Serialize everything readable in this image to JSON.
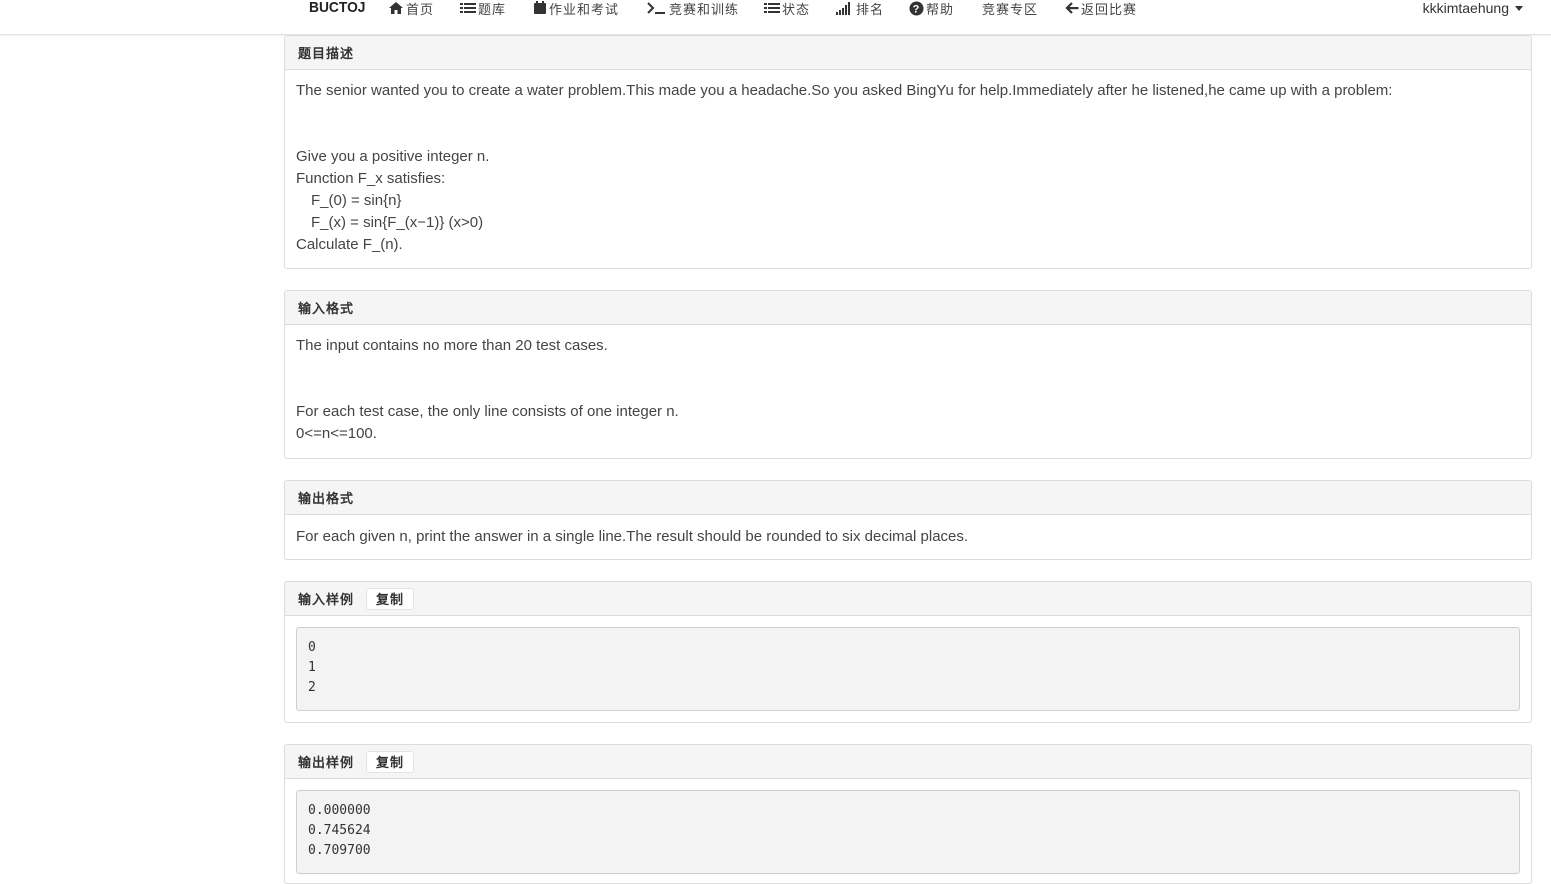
{
  "navbar": {
    "brand": "BUCTOJ",
    "items": [
      {
        "label": "首页",
        "icon": "home-icon"
      },
      {
        "label": "题库",
        "icon": "list-icon"
      },
      {
        "label": "作业和考试",
        "icon": "calendar-icon"
      },
      {
        "label": "竞赛和训练",
        "icon": "terminal-icon"
      },
      {
        "label": "状态",
        "icon": "list-check-icon"
      },
      {
        "label": "排名",
        "icon": "signal-icon"
      },
      {
        "label": "帮助",
        "icon": "question-circle-icon"
      },
      {
        "label": "竞赛专区",
        "icon": ""
      },
      {
        "label": "返回比赛",
        "icon": "arrow-left-icon"
      }
    ],
    "user": "kkkimtaehung"
  },
  "sections": {
    "description": {
      "title": "题目描述",
      "intro": "The senior wanted you to create a water problem.This made you a headache.So you asked BingYu for help.Immediately after he listened,he came up with a problem:",
      "line1": "Give you a positive integer n.",
      "line2": "Function F_x satisfies:",
      "line3": "F_(0) = sin{n}",
      "line4": "F_(x) = sin{F_(x−1)} (x>0)",
      "line5": "Calculate F_(n)."
    },
    "input_format": {
      "title": "输入格式",
      "line1": "The input contains no more than 20 test cases.",
      "line2": "For each test case, the only line consists of one integer n.",
      "line3": "0<=n<=100."
    },
    "output_format": {
      "title": "输出格式",
      "line1": "For each given n, print the answer in a single line.The result should be rounded to six decimal places."
    },
    "sample_input": {
      "title": "输入样例",
      "copy_label": "复制",
      "content": "0\n1\n2"
    },
    "sample_output": {
      "title": "输出样例",
      "copy_label": "复制",
      "content": "0.000000\n0.745624\n0.709700"
    }
  }
}
